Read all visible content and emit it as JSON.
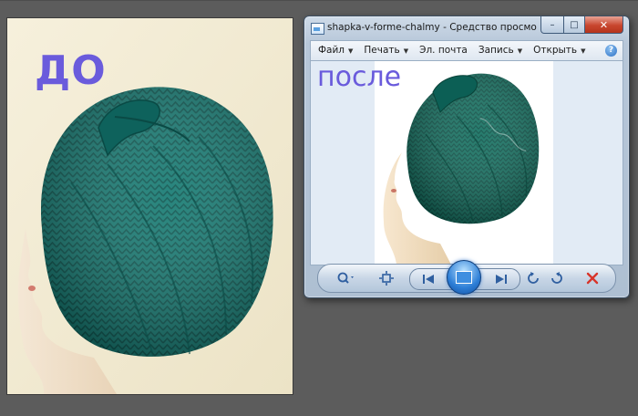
{
  "before_photo": {
    "caption": "ДО"
  },
  "viewer": {
    "title": "shapka-v-forme-chalmy - Средство просмотра фото...",
    "caption_buttons": {
      "minimize": "–",
      "maximize": "□",
      "close": "✕"
    },
    "menu": [
      {
        "label": "Файл",
        "has_dropdown": true
      },
      {
        "label": "Печать",
        "has_dropdown": true
      },
      {
        "label": "Эл. почта",
        "has_dropdown": false
      },
      {
        "label": "Запись",
        "has_dropdown": true
      },
      {
        "label": "Открыть",
        "has_dropdown": true
      }
    ],
    "help_label": "?",
    "image_caption": "после",
    "toolbar": {
      "icons": [
        "zoom-icon",
        "actual-size-icon",
        "previous-icon",
        "slideshow-icon",
        "next-icon",
        "rotate-left-icon",
        "rotate-right-icon",
        "delete-icon"
      ]
    }
  },
  "colors": {
    "caption_purple": "#6a5bdc",
    "hat_teal": "#11706a",
    "desktop_gray": "#5c5c5c",
    "delete_red": "#d8342a"
  }
}
